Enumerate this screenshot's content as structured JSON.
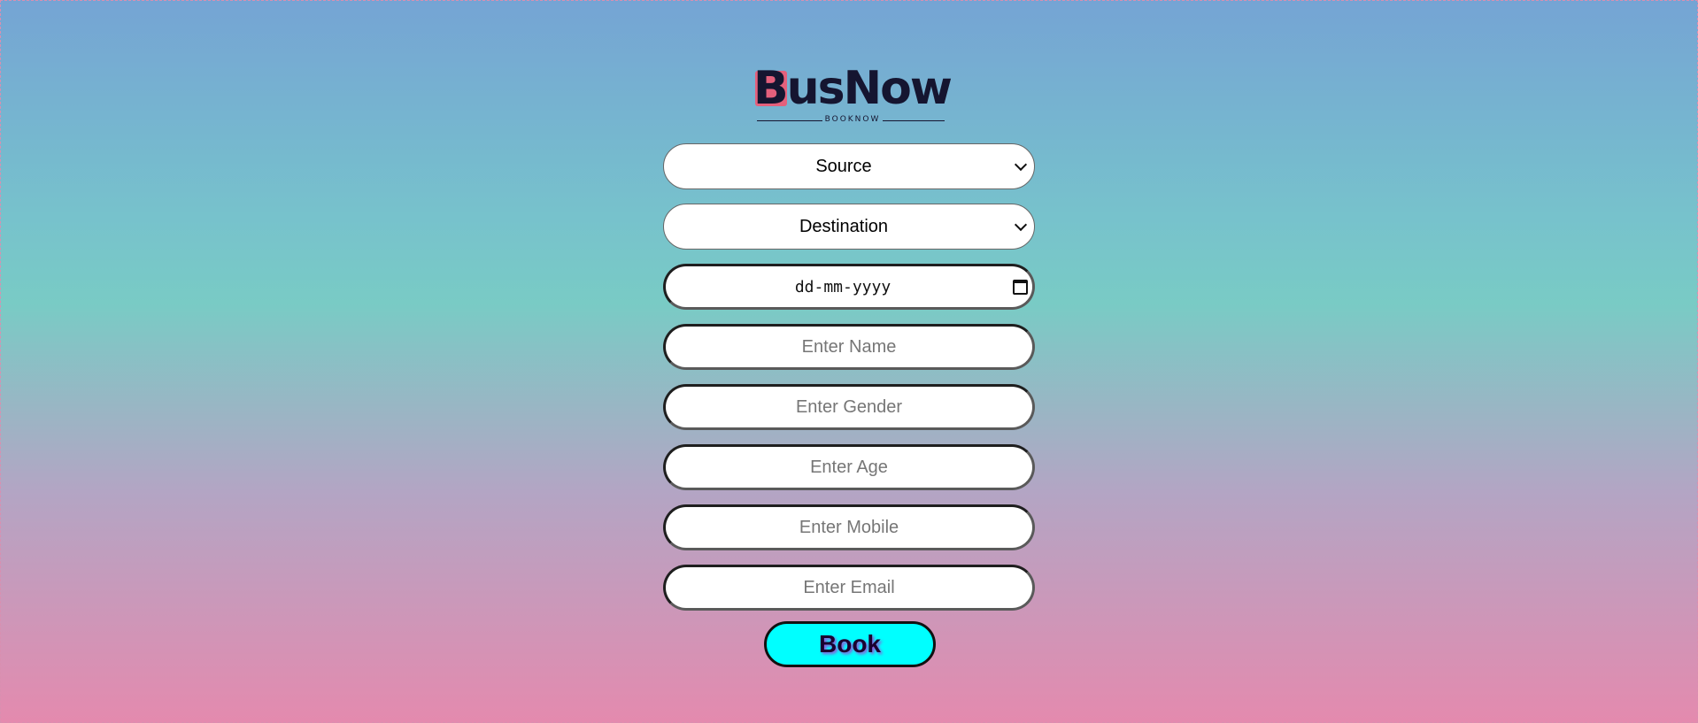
{
  "brand": {
    "name": "BusNow",
    "tagline": "BOOKNOW",
    "accent": "#e4607c"
  },
  "form": {
    "source": {
      "selected": "Source"
    },
    "destination": {
      "selected": "Destination"
    },
    "date": {
      "value": "dd-mm-yyyy"
    },
    "name": {
      "placeholder": "Enter Name"
    },
    "gender": {
      "placeholder": "Enter Gender"
    },
    "age": {
      "placeholder": "Enter Age"
    },
    "mobile": {
      "placeholder": "Enter Mobile"
    },
    "email": {
      "placeholder": "Enter Email"
    },
    "submit_label": "Book"
  },
  "colors": {
    "button_bg": "#00ffff",
    "button_text_shadow": "#9c4bd6",
    "gradient_top": "#75a4d4",
    "gradient_mid": "#79cbc5",
    "gradient_bottom": "#e48aae"
  },
  "icons": {
    "dropdown": "chevron-down-icon",
    "date": "calendar-icon"
  }
}
